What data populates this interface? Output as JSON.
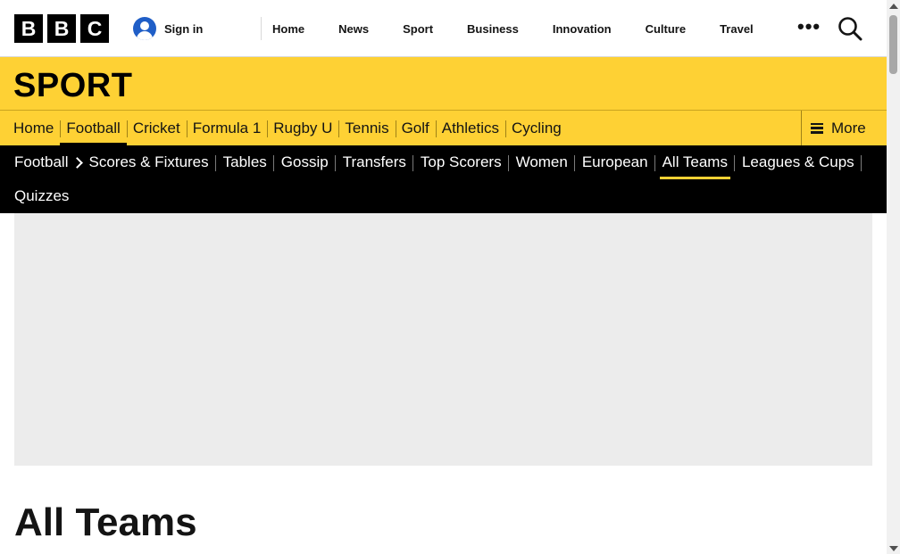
{
  "header": {
    "logo_letters": [
      "B",
      "B",
      "C"
    ],
    "sign_in_label": "Sign in",
    "links": [
      "Home",
      "News",
      "Sport",
      "Business",
      "Innovation",
      "Culture",
      "Travel"
    ],
    "more_icon": "ellipsis-icon",
    "search_icon": "search-icon"
  },
  "sport": {
    "title": "SPORT"
  },
  "primary_nav": {
    "items": [
      "Home",
      "Football",
      "Cricket",
      "Formula 1",
      "Rugby U",
      "Tennis",
      "Golf",
      "Athletics",
      "Cycling"
    ],
    "active": "Football",
    "more_label": "More"
  },
  "secondary_nav": {
    "section": "Football",
    "items": [
      "Scores & Fixtures",
      "Tables",
      "Gossip",
      "Transfers",
      "Top Scorers",
      "Women",
      "European",
      "All Teams",
      "Leagues & Cups",
      "Quizzes"
    ],
    "active": "All Teams"
  },
  "main": {
    "title": "All Teams"
  },
  "colors": {
    "sport_yellow": "#fed134",
    "nav_black": "#000000",
    "placeholder_grey": "#ececec",
    "avatar_blue": "#1f5ec7"
  }
}
